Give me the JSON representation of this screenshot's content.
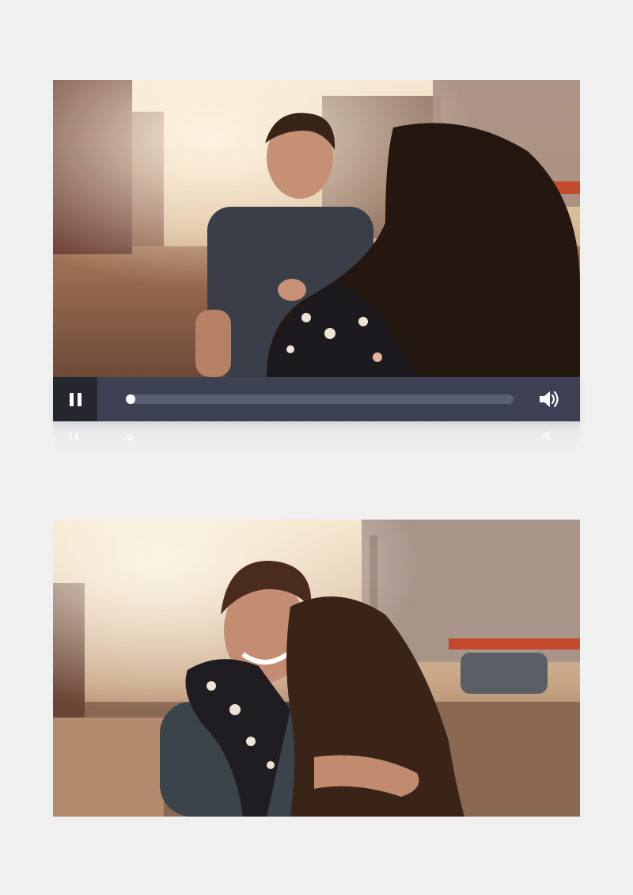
{
  "player": {
    "state": "playing",
    "progress": 0.0,
    "control_icons": {
      "play_pause": "pause-icon",
      "volume": "volume-icon"
    },
    "colors": {
      "control_bar": "#3e4154",
      "play_button_bg": "#25272f",
      "track": "#5b5f74",
      "knob": "#ffffff"
    }
  },
  "frames": [
    {
      "id": "frame-1",
      "scene": "couple-on-sunlit-street"
    },
    {
      "id": "frame-2",
      "scene": "couple-hugging-on-street"
    }
  ]
}
